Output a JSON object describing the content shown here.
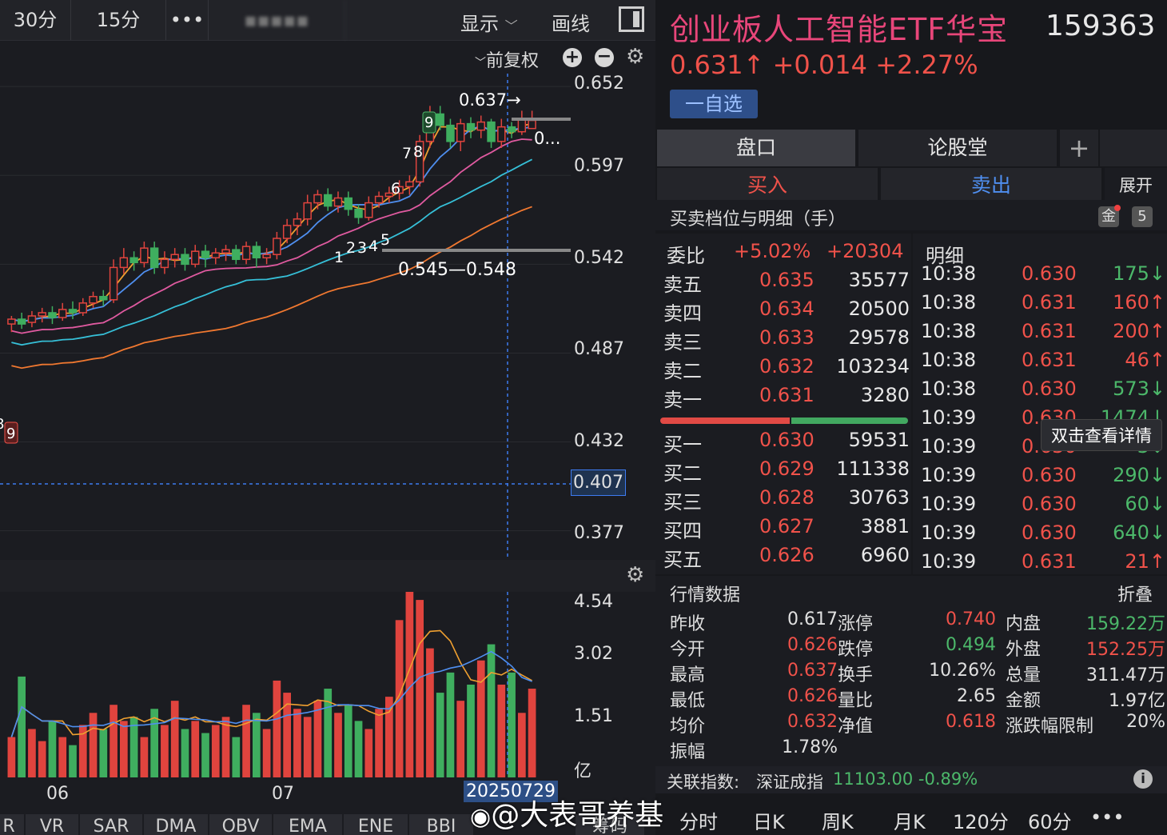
{
  "toolbar": {
    "period_30": "30分",
    "period_15": "15分",
    "more": "•••",
    "blurred": "▪▪▪▪▪",
    "display": "显示",
    "draw": "画线",
    "adjust": "前复权"
  },
  "chart": {
    "y_labels": [
      "0.652",
      "0.597",
      "0.542",
      "0.487",
      "0.432",
      "0.407",
      "0.377"
    ],
    "high_label": "0.637→",
    "price_tag": "0...",
    "range_label": "0.545—0.548",
    "seq_labels": [
      "1",
      "2",
      "3",
      "4",
      "5",
      "6",
      "7",
      "8",
      "9",
      "9",
      "8"
    ],
    "vol_labels": [
      "4.54",
      "3.02",
      "1.51",
      "亿"
    ],
    "x_labels": [
      "06",
      "07"
    ],
    "date_badge": "20250729"
  },
  "chart_data": {
    "type": "candlestick",
    "y_range": [
      0.36,
      0.66
    ],
    "volume_range": [
      0,
      4.6
    ],
    "candles": [
      {
        "o": 0.505,
        "c": 0.508,
        "h": 0.51,
        "l": 0.5
      },
      {
        "o": 0.508,
        "c": 0.505,
        "h": 0.512,
        "l": 0.502
      },
      {
        "o": 0.506,
        "c": 0.51,
        "h": 0.513,
        "l": 0.503
      },
      {
        "o": 0.51,
        "c": 0.512,
        "h": 0.515,
        "l": 0.506
      },
      {
        "o": 0.512,
        "c": 0.509,
        "h": 0.516,
        "l": 0.505
      },
      {
        "o": 0.509,
        "c": 0.514,
        "h": 0.518,
        "l": 0.507
      },
      {
        "o": 0.514,
        "c": 0.512,
        "h": 0.519,
        "l": 0.508
      },
      {
        "o": 0.512,
        "c": 0.518,
        "h": 0.521,
        "l": 0.51
      },
      {
        "o": 0.518,
        "c": 0.522,
        "h": 0.525,
        "l": 0.515
      },
      {
        "o": 0.522,
        "c": 0.52,
        "h": 0.526,
        "l": 0.516
      },
      {
        "o": 0.52,
        "c": 0.54,
        "h": 0.545,
        "l": 0.518
      },
      {
        "o": 0.54,
        "c": 0.546,
        "h": 0.552,
        "l": 0.536
      },
      {
        "o": 0.546,
        "c": 0.543,
        "h": 0.55,
        "l": 0.538
      },
      {
        "o": 0.543,
        "c": 0.552,
        "h": 0.556,
        "l": 0.54
      },
      {
        "o": 0.552,
        "c": 0.54,
        "h": 0.556,
        "l": 0.536
      },
      {
        "o": 0.54,
        "c": 0.545,
        "h": 0.55,
        "l": 0.536
      },
      {
        "o": 0.545,
        "c": 0.548,
        "h": 0.552,
        "l": 0.54
      },
      {
        "o": 0.548,
        "c": 0.542,
        "h": 0.552,
        "l": 0.538
      },
      {
        "o": 0.542,
        "c": 0.55,
        "h": 0.554,
        "l": 0.54
      },
      {
        "o": 0.55,
        "c": 0.546,
        "h": 0.554,
        "l": 0.54
      },
      {
        "o": 0.546,
        "c": 0.549,
        "h": 0.552,
        "l": 0.542
      },
      {
        "o": 0.549,
        "c": 0.551,
        "h": 0.554,
        "l": 0.544
      },
      {
        "o": 0.551,
        "c": 0.545,
        "h": 0.554,
        "l": 0.542
      },
      {
        "o": 0.545,
        "c": 0.553,
        "h": 0.556,
        "l": 0.542
      },
      {
        "o": 0.553,
        "c": 0.546,
        "h": 0.556,
        "l": 0.54
      },
      {
        "o": 0.546,
        "c": 0.548,
        "h": 0.552,
        "l": 0.542
      },
      {
        "o": 0.548,
        "c": 0.558,
        "h": 0.562,
        "l": 0.545
      },
      {
        "o": 0.558,
        "c": 0.566,
        "h": 0.57,
        "l": 0.555
      },
      {
        "o": 0.566,
        "c": 0.57,
        "h": 0.574,
        "l": 0.56
      },
      {
        "o": 0.57,
        "c": 0.58,
        "h": 0.585,
        "l": 0.566
      },
      {
        "o": 0.58,
        "c": 0.585,
        "h": 0.588,
        "l": 0.576
      },
      {
        "o": 0.585,
        "c": 0.578,
        "h": 0.589,
        "l": 0.575
      },
      {
        "o": 0.578,
        "c": 0.583,
        "h": 0.587,
        "l": 0.574
      },
      {
        "o": 0.583,
        "c": 0.576,
        "h": 0.587,
        "l": 0.572
      },
      {
        "o": 0.576,
        "c": 0.571,
        "h": 0.579,
        "l": 0.567
      },
      {
        "o": 0.571,
        "c": 0.58,
        "h": 0.584,
        "l": 0.569
      },
      {
        "o": 0.58,
        "c": 0.584,
        "h": 0.587,
        "l": 0.577
      },
      {
        "o": 0.584,
        "c": 0.586,
        "h": 0.59,
        "l": 0.58
      },
      {
        "o": 0.586,
        "c": 0.59,
        "h": 0.594,
        "l": 0.582
      },
      {
        "o": 0.59,
        "c": 0.593,
        "h": 0.597,
        "l": 0.585
      },
      {
        "o": 0.593,
        "c": 0.618,
        "h": 0.622,
        "l": 0.59
      },
      {
        "o": 0.618,
        "c": 0.635,
        "h": 0.64,
        "l": 0.614
      },
      {
        "o": 0.635,
        "c": 0.628,
        "h": 0.64,
        "l": 0.625
      },
      {
        "o": 0.628,
        "c": 0.618,
        "h": 0.632,
        "l": 0.614
      },
      {
        "o": 0.618,
        "c": 0.629,
        "h": 0.632,
        "l": 0.612
      },
      {
        "o": 0.629,
        "c": 0.625,
        "h": 0.633,
        "l": 0.62
      },
      {
        "o": 0.625,
        "c": 0.63,
        "h": 0.634,
        "l": 0.62
      },
      {
        "o": 0.63,
        "c": 0.618,
        "h": 0.632,
        "l": 0.614
      },
      {
        "o": 0.618,
        "c": 0.627,
        "h": 0.632,
        "l": 0.614
      },
      {
        "o": 0.627,
        "c": 0.624,
        "h": 0.63,
        "l": 0.62
      },
      {
        "o": 0.624,
        "c": 0.632,
        "h": 0.637,
        "l": 0.622
      },
      {
        "o": 0.626,
        "c": 0.631,
        "h": 0.637,
        "l": 0.626
      }
    ],
    "volumes": [
      1.0,
      2.5,
      1.2,
      0.9,
      1.4,
      1.0,
      0.8,
      1.3,
      1.6,
      1.2,
      1.8,
      1.4,
      1.5,
      1.0,
      1.7,
      1.3,
      1.9,
      1.2,
      1.4,
      1.1,
      1.3,
      1.5,
      1.0,
      1.8,
      1.6,
      1.2,
      2.4,
      2.1,
      1.7,
      1.5,
      1.9,
      2.2,
      1.6,
      1.8,
      1.4,
      1.2,
      1.7,
      2.0,
      3.9,
      4.6,
      4.4,
      3.2,
      2.1,
      2.6,
      1.9,
      2.3,
      2.9,
      3.3,
      2.3,
      2.6,
      1.6,
      2.2
    ]
  },
  "stock": {
    "name": "创业板人工智能ETF华宝",
    "code": "159363",
    "price_line": "0.631↑ +0.014 +2.27%",
    "watch": "一自选"
  },
  "tabs": {
    "pankou": "盘口",
    "forum": "论股堂",
    "plus": "+",
    "buy": "买入",
    "sell": "卖出",
    "expand": "展开"
  },
  "orderbook": {
    "title": "买卖档位与明细（手）",
    "badge_num": "5",
    "wb_label": "委比",
    "wb_pct": "+5.02%",
    "wb_num": "+20304",
    "detail": "明细",
    "sells": [
      {
        "label": "卖五",
        "price": "0.635",
        "vol": "35577"
      },
      {
        "label": "卖四",
        "price": "0.634",
        "vol": "20500"
      },
      {
        "label": "卖三",
        "price": "0.633",
        "vol": "29578"
      },
      {
        "label": "卖二",
        "price": "0.632",
        "vol": "103234"
      },
      {
        "label": "卖一",
        "price": "0.631",
        "vol": "3280"
      }
    ],
    "buys": [
      {
        "label": "买一",
        "price": "0.630",
        "vol": "59531"
      },
      {
        "label": "买二",
        "price": "0.629",
        "vol": "111338"
      },
      {
        "label": "买三",
        "price": "0.628",
        "vol": "30763"
      },
      {
        "label": "买四",
        "price": "0.627",
        "vol": "3881"
      },
      {
        "label": "买五",
        "price": "0.626",
        "vol": "6960"
      }
    ]
  },
  "ticks": [
    {
      "time": "10:38",
      "price": "0.630",
      "vol": "175↓",
      "dir": "down"
    },
    {
      "time": "10:38",
      "price": "0.631",
      "vol": "160↑",
      "dir": "up"
    },
    {
      "time": "10:38",
      "price": "0.631",
      "vol": "200↑",
      "dir": "up"
    },
    {
      "time": "10:38",
      "price": "0.631",
      "vol": "46↑",
      "dir": "up"
    },
    {
      "time": "10:38",
      "price": "0.630",
      "vol": "573↓",
      "dir": "down"
    },
    {
      "time": "10:39",
      "price": "0.630",
      "vol": "1474↓",
      "dir": "down"
    },
    {
      "time": "10:39",
      "price": "0.630",
      "vol": "3↓",
      "dir": "down"
    },
    {
      "time": "10:39",
      "price": "0.630",
      "vol": "290↓",
      "dir": "down"
    },
    {
      "time": "10:39",
      "price": "0.630",
      "vol": "60↓",
      "dir": "down"
    },
    {
      "time": "10:39",
      "price": "0.630",
      "vol": "640↓",
      "dir": "down"
    },
    {
      "time": "10:39",
      "price": "0.631",
      "vol": "21↑",
      "dir": "up"
    }
  ],
  "tooltip": "双击查看详情",
  "stats": {
    "title": "行情数据",
    "fold": "折叠",
    "col1": [
      {
        "k": "昨收",
        "v": "0.617",
        "c": "w"
      },
      {
        "k": "今开",
        "v": "0.626",
        "c": "red"
      },
      {
        "k": "最高",
        "v": "0.637",
        "c": "red"
      },
      {
        "k": "最低",
        "v": "0.626",
        "c": "red"
      },
      {
        "k": "均价",
        "v": "0.632",
        "c": "red"
      },
      {
        "k": "振幅",
        "v": "1.78%",
        "c": "w"
      }
    ],
    "col2": [
      {
        "k": "涨停",
        "v": "0.740",
        "c": "red"
      },
      {
        "k": "跌停",
        "v": "0.494",
        "c": "green"
      },
      {
        "k": "换手",
        "v": "10.26%",
        "c": "w"
      },
      {
        "k": "量比",
        "v": "2.65",
        "c": "w"
      },
      {
        "k": "净值",
        "v": "0.618",
        "c": "red"
      }
    ],
    "col3": [
      {
        "k": "内盘",
        "v": "159.22万",
        "c": "green"
      },
      {
        "k": "外盘",
        "v": "152.25万",
        "c": "red"
      },
      {
        "k": "总量",
        "v": "311.47万",
        "c": "w"
      },
      {
        "k": "金额",
        "v": "1.97亿",
        "c": "w"
      },
      {
        "k": "涨跌幅限制",
        "v": "20%",
        "c": "w"
      }
    ]
  },
  "index": {
    "label": "关联指数:",
    "name": "深证成指",
    "value": "11103.00 -0.89%"
  },
  "periods": [
    "分时",
    "日K",
    "周K",
    "月K",
    "120分",
    "60分",
    "•••"
  ],
  "indicators": [
    "R",
    "VR",
    "SAR",
    "DMA",
    "OBV",
    "EMA",
    "ENE",
    "BBI"
  ],
  "chip": "筹码",
  "watermark": "@大表哥养基",
  "colors": {
    "up": "#f0524a",
    "down": "#4cb86a",
    "accent": "#e8467a",
    "bg": "#17181c"
  }
}
